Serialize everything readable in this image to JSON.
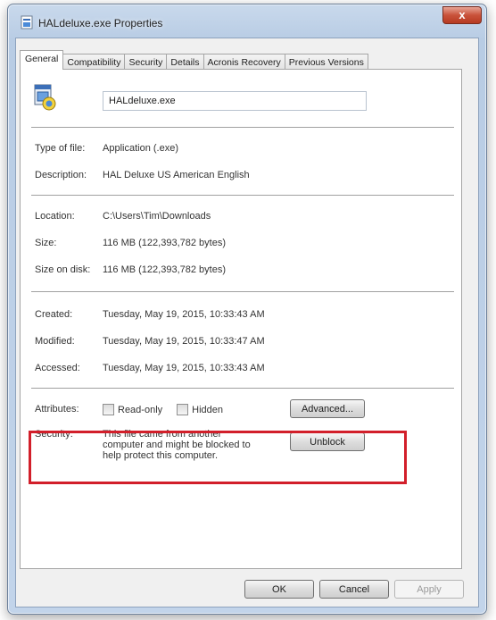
{
  "window": {
    "title": "HALdeluxe.exe Properties",
    "close_glyph": "x",
    "accent": "#d21f2a"
  },
  "tabs": [
    {
      "label": "General",
      "active": true
    },
    {
      "label": "Compatibility",
      "active": false
    },
    {
      "label": "Security",
      "active": false
    },
    {
      "label": "Details",
      "active": false
    },
    {
      "label": "Acronis Recovery",
      "active": false
    },
    {
      "label": "Previous Versions",
      "active": false
    }
  ],
  "general": {
    "file_name": "HALdeluxe.exe",
    "type_label": "Type of file:",
    "type_value": "Application (.exe)",
    "description_label": "Description:",
    "description_value": "HAL Deluxe US American English",
    "location_label": "Location:",
    "location_value": "C:\\Users\\Tim\\Downloads",
    "size_label": "Size:",
    "size_value": "116 MB (122,393,782 bytes)",
    "size_on_disk_label": "Size on disk:",
    "size_on_disk_value": "116 MB (122,393,782 bytes)",
    "created_label": "Created:",
    "created_value": "Tuesday, May 19, 2015, 10:33:43 AM",
    "modified_label": "Modified:",
    "modified_value": "Tuesday, May 19, 2015, 10:33:47 AM",
    "accessed_label": "Accessed:",
    "accessed_value": "Tuesday, May 19, 2015, 10:33:43 AM",
    "attributes_label": "Attributes:",
    "readonly_label": "Read-only",
    "readonly_checked": false,
    "hidden_label": "Hidden",
    "hidden_checked": false,
    "advanced_label": "Advanced...",
    "security_label": "Security:",
    "security_line1": "This file came from another",
    "security_line2": "computer and might be blocked to",
    "security_line3": "help protect this computer.",
    "unblock_label": "Unblock"
  },
  "footer": {
    "ok_label": "OK",
    "cancel_label": "Cancel",
    "apply_label": "Apply"
  }
}
